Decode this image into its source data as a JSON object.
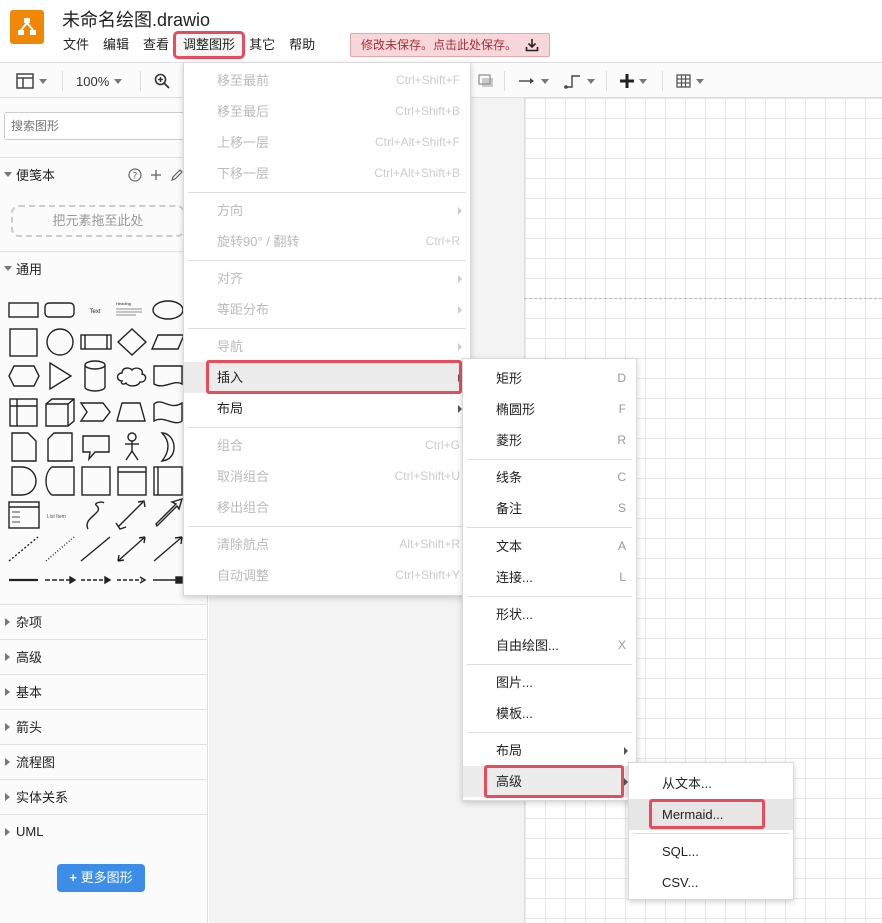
{
  "app": {
    "title": "未命名绘图.drawio",
    "brand_color": "#f08705"
  },
  "menubar": [
    {
      "label": "文件"
    },
    {
      "label": "编辑"
    },
    {
      "label": "查看"
    },
    {
      "label": "调整图形",
      "active": true
    },
    {
      "label": "其它"
    },
    {
      "label": "帮助"
    }
  ],
  "unsaved_notice": "修改未保存。点击此处保存。",
  "toolbar": {
    "zoom": "100%"
  },
  "sidebar": {
    "search_placeholder": "搜索图形",
    "scratchpad": {
      "title": "便笺本",
      "drop_hint": "把元素拖至此处"
    },
    "general": {
      "title": "通用"
    },
    "sections": [
      "杂项",
      "高级",
      "基本",
      "箭头",
      "流程图",
      "实体关系",
      "UML"
    ],
    "more_shapes": "更多图形"
  },
  "arrange_menu": {
    "items": [
      {
        "label": "移至最前",
        "shortcut": "Ctrl+Shift+F",
        "disabled": true
      },
      {
        "label": "移至最后",
        "shortcut": "Ctrl+Shift+B",
        "disabled": true
      },
      {
        "label": "上移一层",
        "shortcut": "Ctrl+Alt+Shift+F",
        "disabled": true
      },
      {
        "label": "下移一层",
        "shortcut": "Ctrl+Alt+Shift+B",
        "disabled": true
      },
      {
        "label": "方向",
        "submenu": true,
        "disabled": true
      },
      {
        "label": "旋转90° / 翻转",
        "shortcut": "Ctrl+R",
        "disabled": true
      },
      {
        "label": "对齐",
        "submenu": true,
        "disabled": true
      },
      {
        "label": "等距分布",
        "submenu": true,
        "disabled": true
      },
      {
        "label": "导航",
        "submenu": true,
        "disabled": true
      },
      {
        "label": "插入",
        "submenu": true,
        "disabled": false,
        "highlighted": true
      },
      {
        "label": "布局",
        "submenu": true,
        "disabled": false
      },
      {
        "label": "组合",
        "shortcut": "Ctrl+G",
        "disabled": true
      },
      {
        "label": "取消组合",
        "shortcut": "Ctrl+Shift+U",
        "disabled": true
      },
      {
        "label": "移出组合",
        "disabled": true
      },
      {
        "label": "清除航点",
        "shortcut": "Alt+Shift+R",
        "disabled": true
      },
      {
        "label": "自动调整",
        "shortcut": "Ctrl+Shift+Y",
        "disabled": true
      }
    ]
  },
  "insert_menu": {
    "items": [
      {
        "label": "矩形",
        "shortcut": "D"
      },
      {
        "label": "椭圆形",
        "shortcut": "F"
      },
      {
        "label": "菱形",
        "shortcut": "R"
      },
      {
        "label": "线条",
        "shortcut": "C"
      },
      {
        "label": "备注",
        "shortcut": "S"
      },
      {
        "label": "文本",
        "shortcut": "A"
      },
      {
        "label": "连接...",
        "shortcut": "L"
      },
      {
        "label": "形状..."
      },
      {
        "label": "自由绘图...",
        "shortcut": "X"
      },
      {
        "label": "图片..."
      },
      {
        "label": "模板..."
      },
      {
        "label": "布局",
        "submenu": true
      },
      {
        "label": "高级",
        "submenu": true,
        "highlighted": true
      }
    ]
  },
  "advanced_menu": {
    "items": [
      {
        "label": "从文本..."
      },
      {
        "label": "Mermaid...",
        "highlighted": true
      },
      {
        "label": "SQL..."
      },
      {
        "label": "CSV..."
      }
    ]
  },
  "highlight_color": "#e84c5c"
}
